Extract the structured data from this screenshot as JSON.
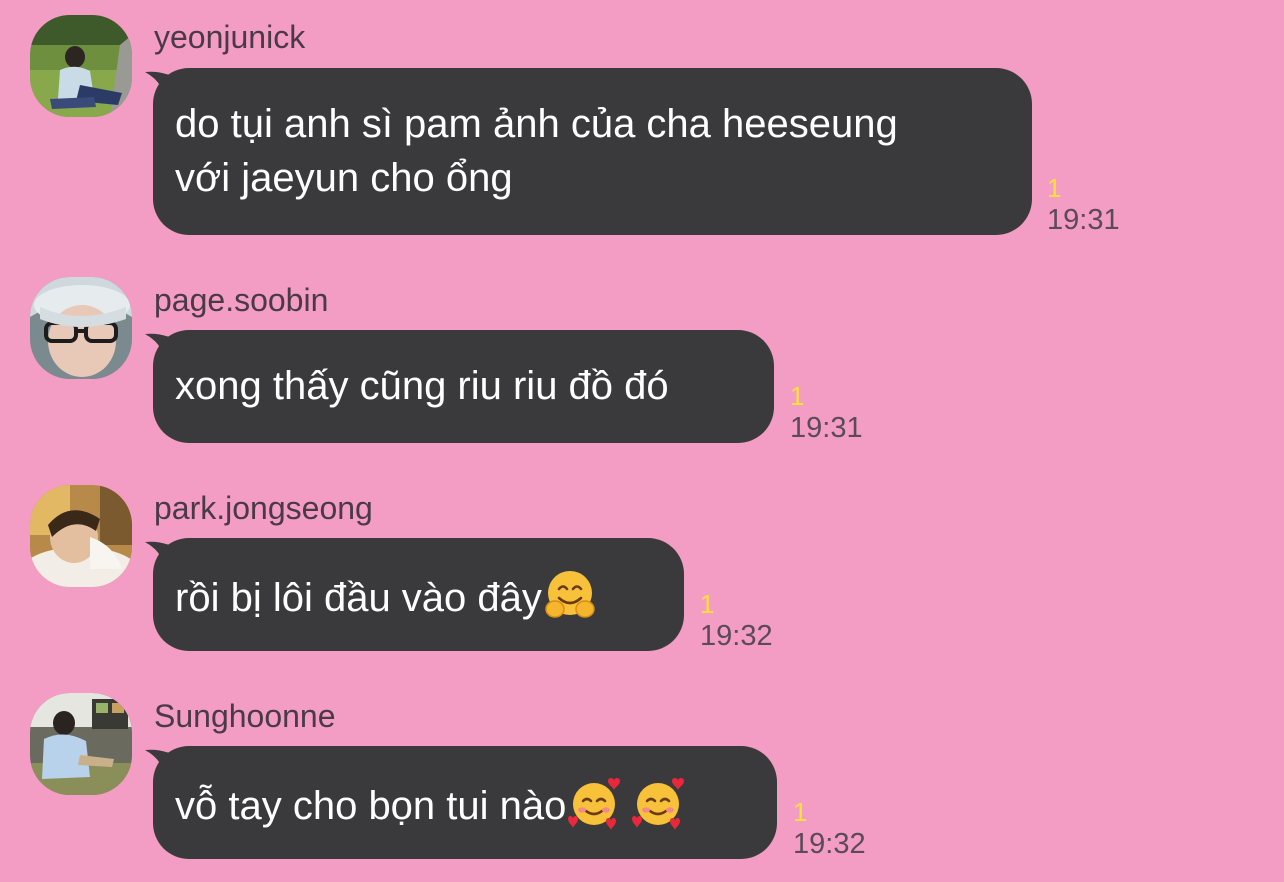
{
  "colors": {
    "background": "#f39cc4",
    "bubble": "#3a3a3c",
    "bubble_text": "#ffffff",
    "unread_count": "#ffdf3a",
    "timestamp": "#5b4a58"
  },
  "messages": [
    {
      "sender": "yeonjunick",
      "text_line1": "do tụi anh sì pam ảnh của cha heeseung",
      "text_line2": "với jaeyun cho ổng",
      "unread": "1",
      "time": "19:31"
    },
    {
      "sender": "page.soobin",
      "text": "xong thấy cũng riu riu đồ đó",
      "unread": "1",
      "time": "19:31"
    },
    {
      "sender": "park.jongseong",
      "text": "rồi bị lôi đầu vào đây",
      "emoji": "hugging-face-emoji",
      "unread": "1",
      "time": "19:32"
    },
    {
      "sender": "Sunghoonne",
      "text": "vỗ tay cho bọn tui nào",
      "emoji": "smiling-face-with-hearts-emoji",
      "unread": "1",
      "time": "19:32"
    }
  ]
}
